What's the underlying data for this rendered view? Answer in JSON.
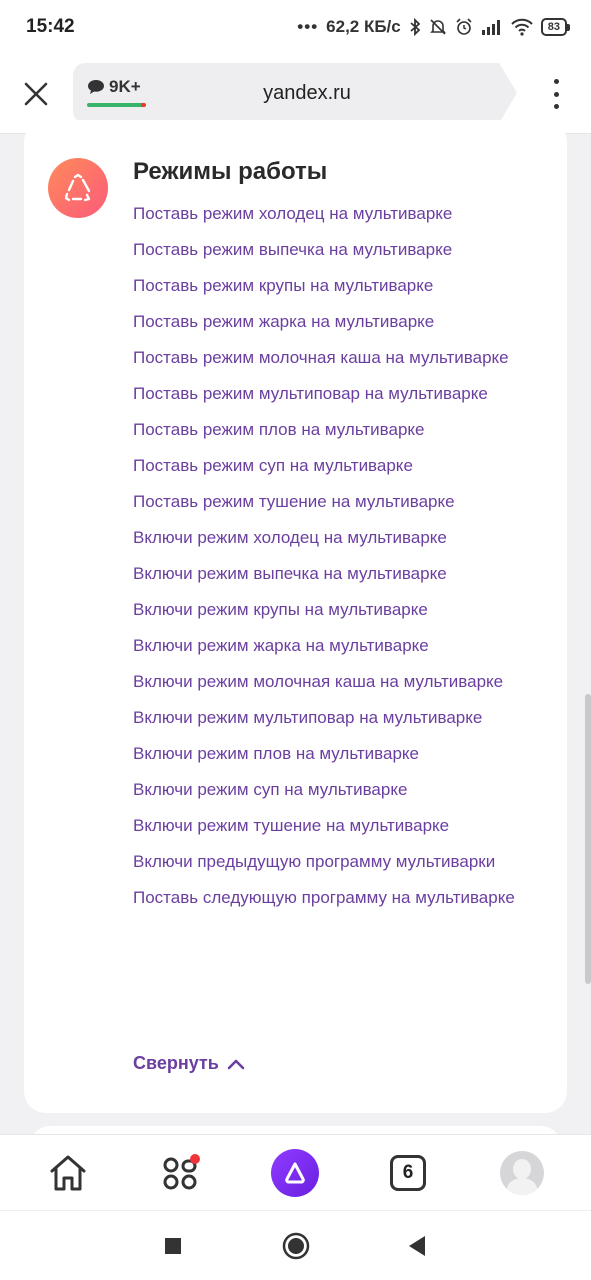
{
  "status_bar": {
    "time": "15:42",
    "network_speed": "62,2 КБ/с",
    "battery": "83"
  },
  "browser": {
    "comments_count": "9K+",
    "url": "yandex.ru"
  },
  "card": {
    "title": "Режимы работы",
    "commands": [
      "Поставь режим холодец на мультиварке",
      "Поставь режим выпечка на мультиварке",
      "Поставь режим крупы на мультиварке",
      "Поставь режим жарка на мультиварке",
      "Поставь режим молочная каша на мультиварке",
      "Поставь режим мультиповар на мультиварке",
      "Поставь режим плов на мультиварке",
      "Поставь режим суп на мультиварке",
      "Поставь режим тушение на мультиварке",
      "Включи режим холодец на мультиварке",
      "Включи режим выпечка на мультиварке",
      "Включи режим крупы на мультиварке",
      "Включи режим жарка на мультиварке",
      "Включи режим молочная каша на мультиварке",
      "Включи режим мультиповар на мультиварке",
      "Включи режим плов на мультиварке",
      "Включи режим суп на мультиварке",
      "Включи режим тушение на мультиварке",
      "Включи предыдущую программу мультиварки",
      "Поставь следующую программу на мультиварке"
    ],
    "collapse_label": "Свернуть"
  },
  "bottom_nav": {
    "tabs_count": "6"
  },
  "colors": {
    "link": "#6b3fa0",
    "alice": "#7b2cf0",
    "icon_gradient_start": "#ff8a5b",
    "icon_gradient_end": "#fb5b7a"
  }
}
